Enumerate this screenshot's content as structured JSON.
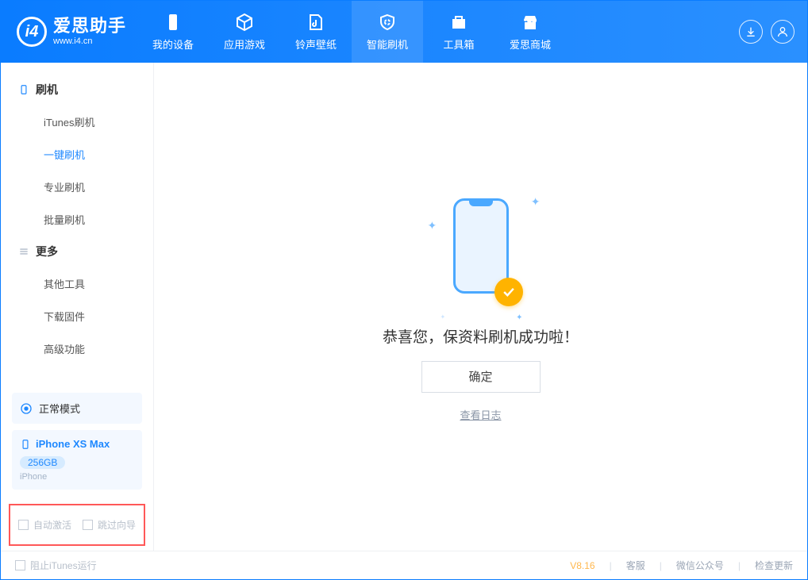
{
  "app": {
    "title": "爱思助手",
    "subtitle": "www.i4.cn"
  },
  "nav": {
    "items": [
      {
        "label": "我的设备"
      },
      {
        "label": "应用游戏"
      },
      {
        "label": "铃声壁纸"
      },
      {
        "label": "智能刷机"
      },
      {
        "label": "工具箱"
      },
      {
        "label": "爱思商城"
      }
    ]
  },
  "sidebar": {
    "group_flash": "刷机",
    "items_flash": [
      {
        "label": "iTunes刷机"
      },
      {
        "label": "一键刷机"
      },
      {
        "label": "专业刷机"
      },
      {
        "label": "批量刷机"
      }
    ],
    "group_more": "更多",
    "items_more": [
      {
        "label": "其他工具"
      },
      {
        "label": "下载固件"
      },
      {
        "label": "高级功能"
      }
    ]
  },
  "device": {
    "mode": "正常模式",
    "name": "iPhone XS Max",
    "capacity": "256GB",
    "type": "iPhone"
  },
  "options": {
    "auto_activate": "自动激活",
    "skip_wizard": "跳过向导"
  },
  "main": {
    "success": "恭喜您，保资料刷机成功啦！",
    "ok": "确定",
    "view_log": "查看日志"
  },
  "footer": {
    "block_itunes": "阻止iTunes运行",
    "version": "V8.16",
    "support": "客服",
    "wechat": "微信公众号",
    "check_update": "检查更新"
  }
}
